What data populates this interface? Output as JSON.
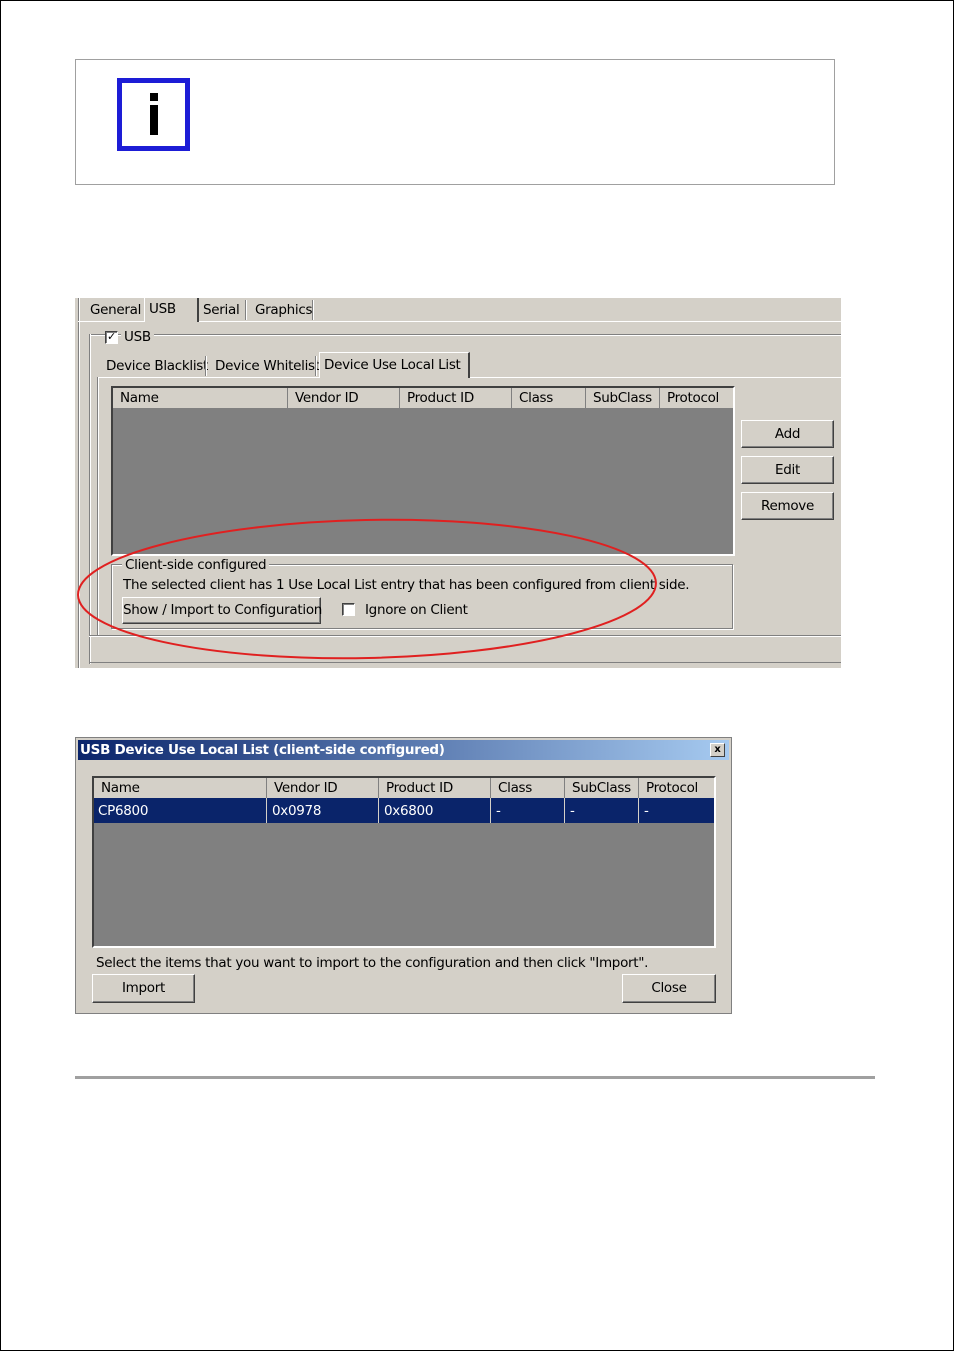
{
  "note": {
    "icon": "info-icon"
  },
  "usb_config": {
    "top_tabs": [
      "General",
      "USB",
      "Serial",
      "Graphics"
    ],
    "usb_checkbox": {
      "label": "USB",
      "checked": true
    },
    "sub_tabs": [
      "Device Blacklist",
      "Device Whitelist",
      "Device Use Local List"
    ],
    "list_columns": [
      "Name",
      "Vendor ID",
      "Product ID",
      "Class",
      "SubClass",
      "Protocol"
    ],
    "buttons": {
      "add": "Add",
      "edit": "Edit",
      "remove": "Remove"
    },
    "client_group": {
      "title": "Client-side configured",
      "message": "The selected client has 1 Use Local List entry that has been configured from client side.",
      "show_import_button": "Show / Import to Configuration",
      "ignore_checkbox": "Ignore on Client",
      "ignore_checked": false
    },
    "highlight_color": "#e02020"
  },
  "dialog": {
    "title": "USB Device Use Local List (client-side configured)",
    "close_glyph": "x",
    "columns": [
      "Name",
      "Vendor ID",
      "Product ID",
      "Class",
      "SubClass",
      "Protocol"
    ],
    "rows": [
      {
        "name": "CP6800",
        "vendor_id": "0x0978",
        "product_id": "0x6800",
        "class": "-",
        "subclass": "-",
        "protocol": "-"
      }
    ],
    "instruction": "Select the items that you want to import to the configuration and then click \"Import\".",
    "import_button": "Import",
    "close_button": "Close"
  }
}
